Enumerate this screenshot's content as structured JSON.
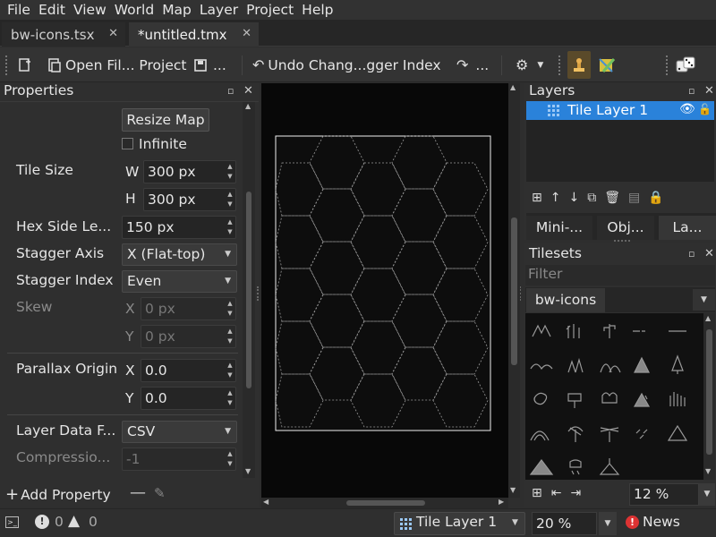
{
  "menu": [
    "File",
    "Edit",
    "View",
    "World",
    "Map",
    "Layer",
    "Project",
    "Help"
  ],
  "tabs": [
    {
      "label": "bw-icons.tsx",
      "close": "✕"
    },
    {
      "label": "*untitled.tmx",
      "close": "✕"
    }
  ],
  "toolbar": {
    "open_file": "Open Fil... Project",
    "save_more": "...",
    "undo": "Undo Chang...gger Index",
    "redo_more": "..."
  },
  "properties": {
    "title": "Properties",
    "resize_map": "Resize Map",
    "infinite": "Infinite",
    "tile_size": "Tile Size",
    "w_label": "W",
    "w_value": "300 px",
    "h_label": "H",
    "h_value": "300 px",
    "hex_side": "Hex Side Le...",
    "hex_value": "150 px",
    "stagger_axis": "Stagger Axis",
    "stagger_axis_value": "X (Flat-top)",
    "stagger_index": "Stagger Index",
    "stagger_index_value": "Even",
    "skew": "Skew",
    "skew_x_label": "X",
    "skew_x_value": "0 px",
    "skew_y_label": "Y",
    "skew_y_value": "0 px",
    "parallax": "Parallax Origin",
    "parallax_x_label": "X",
    "parallax_x_value": "0.0",
    "parallax_y_label": "Y",
    "parallax_y_value": "0.0",
    "layer_data": "Layer Data F...",
    "layer_data_value": "CSV",
    "compression": "Compressio...",
    "compression_value": "-1",
    "add_property": "Add Property"
  },
  "layers": {
    "title": "Layers",
    "item": "Tile Layer 1",
    "tabs": [
      "Mini-...",
      "Obj...",
      "La..."
    ]
  },
  "tilesets": {
    "title": "Tilesets",
    "filter": "Filter",
    "tab": "bw-icons",
    "zoom": "12 %"
  },
  "status": {
    "errors": "0",
    "warnings": "0",
    "layer": "Tile Layer 1",
    "zoom": "20 %",
    "news": "News"
  },
  "colors": {
    "selection": "#2a82da",
    "canvas": "#080808"
  }
}
